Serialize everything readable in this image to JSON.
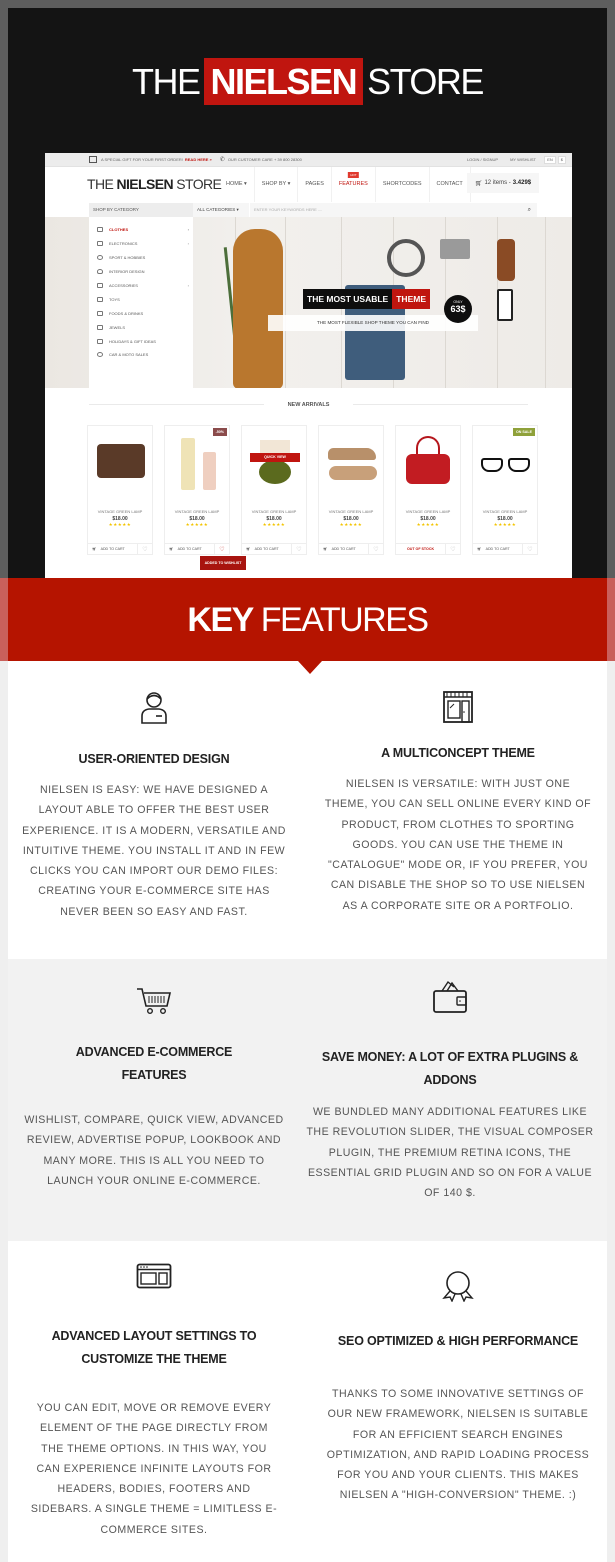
{
  "header": {
    "title_pre": "THE",
    "title_brand": "NIELSEN",
    "title_post": "STORE"
  },
  "mockup": {
    "topbar": {
      "gift_text": "A SPECIAL GIFT FOR YOUR FIRST ORDER!",
      "read_here": "READ HERE »",
      "customer_care": "OUR CUSTOMER CARE + 39 800 28300",
      "login": "LOGIN / SIGNUP",
      "wishlist": "MY WISHLIST",
      "lang": "EN",
      "currency": "$"
    },
    "logo_pre": "THE ",
    "logo_brand": "NIELSEN",
    "logo_post": " STORE",
    "menu": [
      {
        "label": "HOME ▾"
      },
      {
        "label": "SHOP BY ▾"
      },
      {
        "label": "PAGES"
      },
      {
        "label": "FEATURES",
        "badge": "HOT"
      },
      {
        "label": "SHORTCODES"
      },
      {
        "label": "CONTACT"
      }
    ],
    "cart": {
      "items": "12 items -",
      "total": "3.429$"
    },
    "search": {
      "shop_by_category": "SHOP BY CATEGORY",
      "all_categories": "ALL CATEGORIES ▾",
      "placeholder": "ENTER YOUR KEYWORDS HERE ...."
    },
    "categories": [
      {
        "label": "CLOTHES",
        "active": true,
        "has_sub": true
      },
      {
        "label": "ELECTRONICS",
        "has_sub": true
      },
      {
        "label": "SPORT & HOBBIES"
      },
      {
        "label": "INTERIOR DESIGN"
      },
      {
        "label": "ACCESSORIES",
        "has_sub": true
      },
      {
        "label": "TOYS"
      },
      {
        "label": "FOODS & DRINKS"
      },
      {
        "label": "JEWELS"
      },
      {
        "label": "HOLIDAYS & GIFT IDEAS"
      },
      {
        "label": "CAR & MOTO SALES"
      }
    ],
    "banner": {
      "head_a": "THE MOST USABLE",
      "head_b": "THEME",
      "sub": "THE MOST FLEXIBLE SHOP THEME YOU CAN FIND",
      "only": "ONLY",
      "price": "63$"
    },
    "new_arrivals": "NEW ARRIVALS",
    "products": [
      {
        "name": "VINTAGE GREEN LAMP",
        "price": "$18.00",
        "stars": "★★★★★",
        "action": "ADD TO CART",
        "image": "leather-bag"
      },
      {
        "name": "VINTAGE GREEN LAMP",
        "price": "$18.00",
        "stars": "★★★★★",
        "action": "ADD TO CART",
        "badge": "-50%",
        "wish_active": true,
        "image": "perfume-bottles"
      },
      {
        "name": "VINTAGE GREEN LAMP",
        "price": "$18.00",
        "stars": "★★★★★",
        "action": "ADD TO CART",
        "quick_view": "QUICK VIEW",
        "image": "green-lamp"
      },
      {
        "name": "VINTAGE GREEN LAMP",
        "price": "$18.00",
        "stars": "★★★★★",
        "action": "ADD TO CART",
        "image": "sneakers"
      },
      {
        "name": "VINTAGE GREEN LAMP",
        "price": "$18.00",
        "stars": "★★★★★",
        "action": "OUT OF STOCK",
        "image": "red-handbag"
      },
      {
        "name": "VINTAGE GREEN LAMP",
        "price": "$18.00",
        "stars": "★★★★★",
        "action": "ADD TO CART",
        "badge": "ON SALE",
        "image": "glasses"
      }
    ],
    "tooltip": "ADDED TO WISHLIST"
  },
  "key_features": {
    "bold": "KEY",
    "rest": " FEATURES"
  },
  "features": [
    {
      "icon": "user-icon",
      "title": "USER-ORIENTED DESIGN",
      "text": "NIELSEN IS EASY: WE HAVE DESIGNED A LAYOUT ABLE TO OFFER THE BEST USER EXPERIENCE. IT IS A MODERN, VERSATILE AND INTUITIVE THEME. YOU INSTALL IT AND IN FEW CLICKS YOU CAN IMPORT OUR DEMO FILES: CREATING YOUR E-COMMERCE SITE HAS NEVER BEEN SO EASY AND FAST."
    },
    {
      "icon": "storefront-icon",
      "title": "A MULTICONCEPT THEME",
      "text": "NIELSEN IS VERSATILE: WITH JUST ONE THEME, YOU CAN SELL ONLINE EVERY KIND OF PRODUCT, FROM CLOTHES TO SPORTING GOODS. YOU CAN USE THE THEME IN \"CATALOGUE\" MODE OR, IF YOU PREFER, YOU CAN DISABLE THE SHOP SO TO USE NIELSEN AS A CORPORATE SITE OR A PORTFOLIO."
    },
    {
      "icon": "shopping-cart-icon",
      "title": "ADVANCED E-COMMERCE FEATURES",
      "text": "WISHLIST, COMPARE, QUICK VIEW, ADVANCED REVIEW, ADVERTISE POPUP, LOOKBOOK AND MANY MORE. THIS IS ALL YOU NEED TO LAUNCH YOUR ONLINE E-COMMERCE."
    },
    {
      "icon": "wallet-icon",
      "title": "SAVE MONEY: A LOT OF EXTRA PLUGINS & ADDONS",
      "text": "WE BUNDLED MANY ADDITIONAL FEATURES LIKE THE REVOLUTION SLIDER, THE VISUAL COMPOSER PLUGIN, THE PREMIUM RETINA ICONS, THE ESSENTIAL GRID PLUGIN AND SO ON FOR A VALUE OF 140 $."
    },
    {
      "icon": "layout-window-icon",
      "title": "ADVANCED LAYOUT SETTINGS TO CUSTOMIZE THE THEME",
      "text": "YOU CAN EDIT, MOVE OR REMOVE EVERY ELEMENT OF THE PAGE DIRECTLY FROM THE THEME OPTIONS. IN THIS WAY, YOU CAN EXPERIENCE INFINITE LAYOUTS FOR HEADERS, BODIES, FOOTERS AND SIDEBARS. A SINGLE THEME = LIMITLESS E-COMMERCE SITES."
    },
    {
      "icon": "award-ribbon-icon",
      "title": "SEO OPTIMIZED & HIGH PERFORMANCE",
      "text": "THANKS TO SOME INNOVATIVE SETTINGS OF OUR NEW FRAMEWORK, NIELSEN IS SUITABLE FOR AN EFFICIENT SEARCH ENGINES OPTIMIZATION, AND RAPID LOADING PROCESS FOR YOU AND YOUR CLIENTS. THIS MAKES NIELSEN A \"HIGH-CONVERSION\" THEME. :)"
    }
  ],
  "colors": {
    "brand_red": "#c0150f",
    "band_red": "#b51400",
    "dark_bg": "#141414",
    "star": "#f3c400",
    "on_sale": "#8fa13a",
    "discount": "#8a4b4b"
  }
}
